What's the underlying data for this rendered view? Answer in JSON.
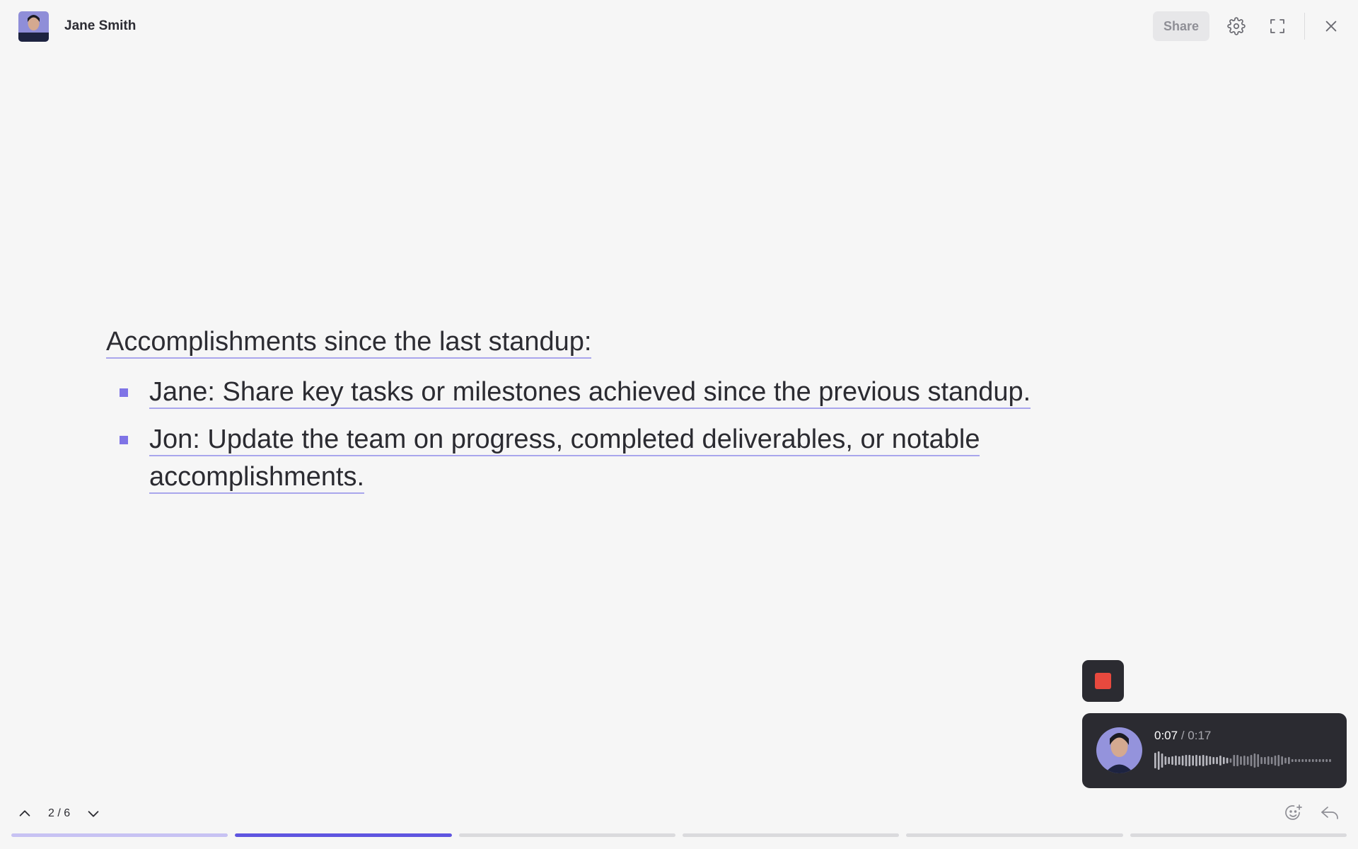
{
  "header": {
    "user_name": "Jane Smith",
    "share_label": "Share",
    "icons": [
      "gear-icon",
      "fullscreen-icon",
      "close-icon"
    ]
  },
  "slide": {
    "heading": "Accomplishments since the last standup:",
    "bullets": [
      {
        "text": "Jane: Share key tasks or milestones achieved since the previous standup."
      },
      {
        "text": "Jon: Update the team on progress, completed deliverables, or notable accomplishments."
      }
    ]
  },
  "player": {
    "current_time": "0:07",
    "separator": " / ",
    "total_time": "0:17",
    "played_fraction": 0.41
  },
  "navigation": {
    "page_indicator": "2 / 6",
    "current_page": 2,
    "total_pages": 6
  },
  "progress": {
    "segments": [
      {
        "state": "completed",
        "fill": 1.0
      },
      {
        "state": "current",
        "fill": 1.0
      },
      {
        "state": "upcoming",
        "fill": 0
      },
      {
        "state": "upcoming",
        "fill": 0
      },
      {
        "state": "upcoming",
        "fill": 0
      },
      {
        "state": "upcoming",
        "fill": 0
      }
    ]
  },
  "colors": {
    "accent": "#5f55e0",
    "accent_light": "#c7c2f3",
    "underline": "#a9a6ec",
    "bullet": "#7f74e6",
    "stop": "#e8493e",
    "dark_panel": "#2b2b31",
    "background": "#f6f6f6"
  }
}
